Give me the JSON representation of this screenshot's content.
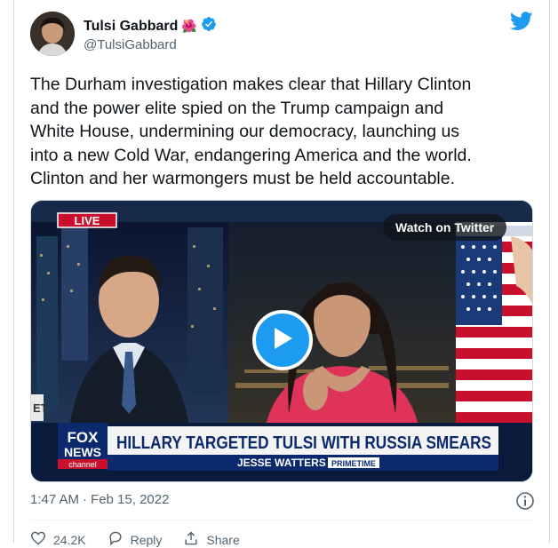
{
  "author": {
    "name": "Tulsi Gabbard",
    "handle": "@TulsiGabbard",
    "emoji": "🌺"
  },
  "tweet": {
    "text": "The Durham investigation makes clear that Hillary Clinton\nand the power elite spied on the Trump campaign and\nWhite House, undermining our democracy, launching us\ninto a new Cold War, endangering America and the world.\nClinton and her warmongers must be held accountable."
  },
  "media": {
    "watch_label": "Watch on Twitter",
    "live_label": "LIVE",
    "headline": "HILLARY TARGETED TULSI WITH RUSSIA SMEARS",
    "show_name": "JESSE WATTERS",
    "show_tag": "PRIMETIME",
    "network_line1": "FOX",
    "network_line2": "NEWS",
    "network_line3": "channel",
    "side_text": "ET"
  },
  "meta": {
    "time": "1:47 AM",
    "separator": "·",
    "date": "Feb 15, 2022"
  },
  "actions": {
    "likes": "24.2K",
    "reply": "Reply",
    "share": "Share"
  },
  "colors": {
    "brand": "#1d9bf0",
    "verified": "#1d9bf0",
    "fox_red": "#c8102e",
    "fox_blue": "#0b2a6e"
  }
}
